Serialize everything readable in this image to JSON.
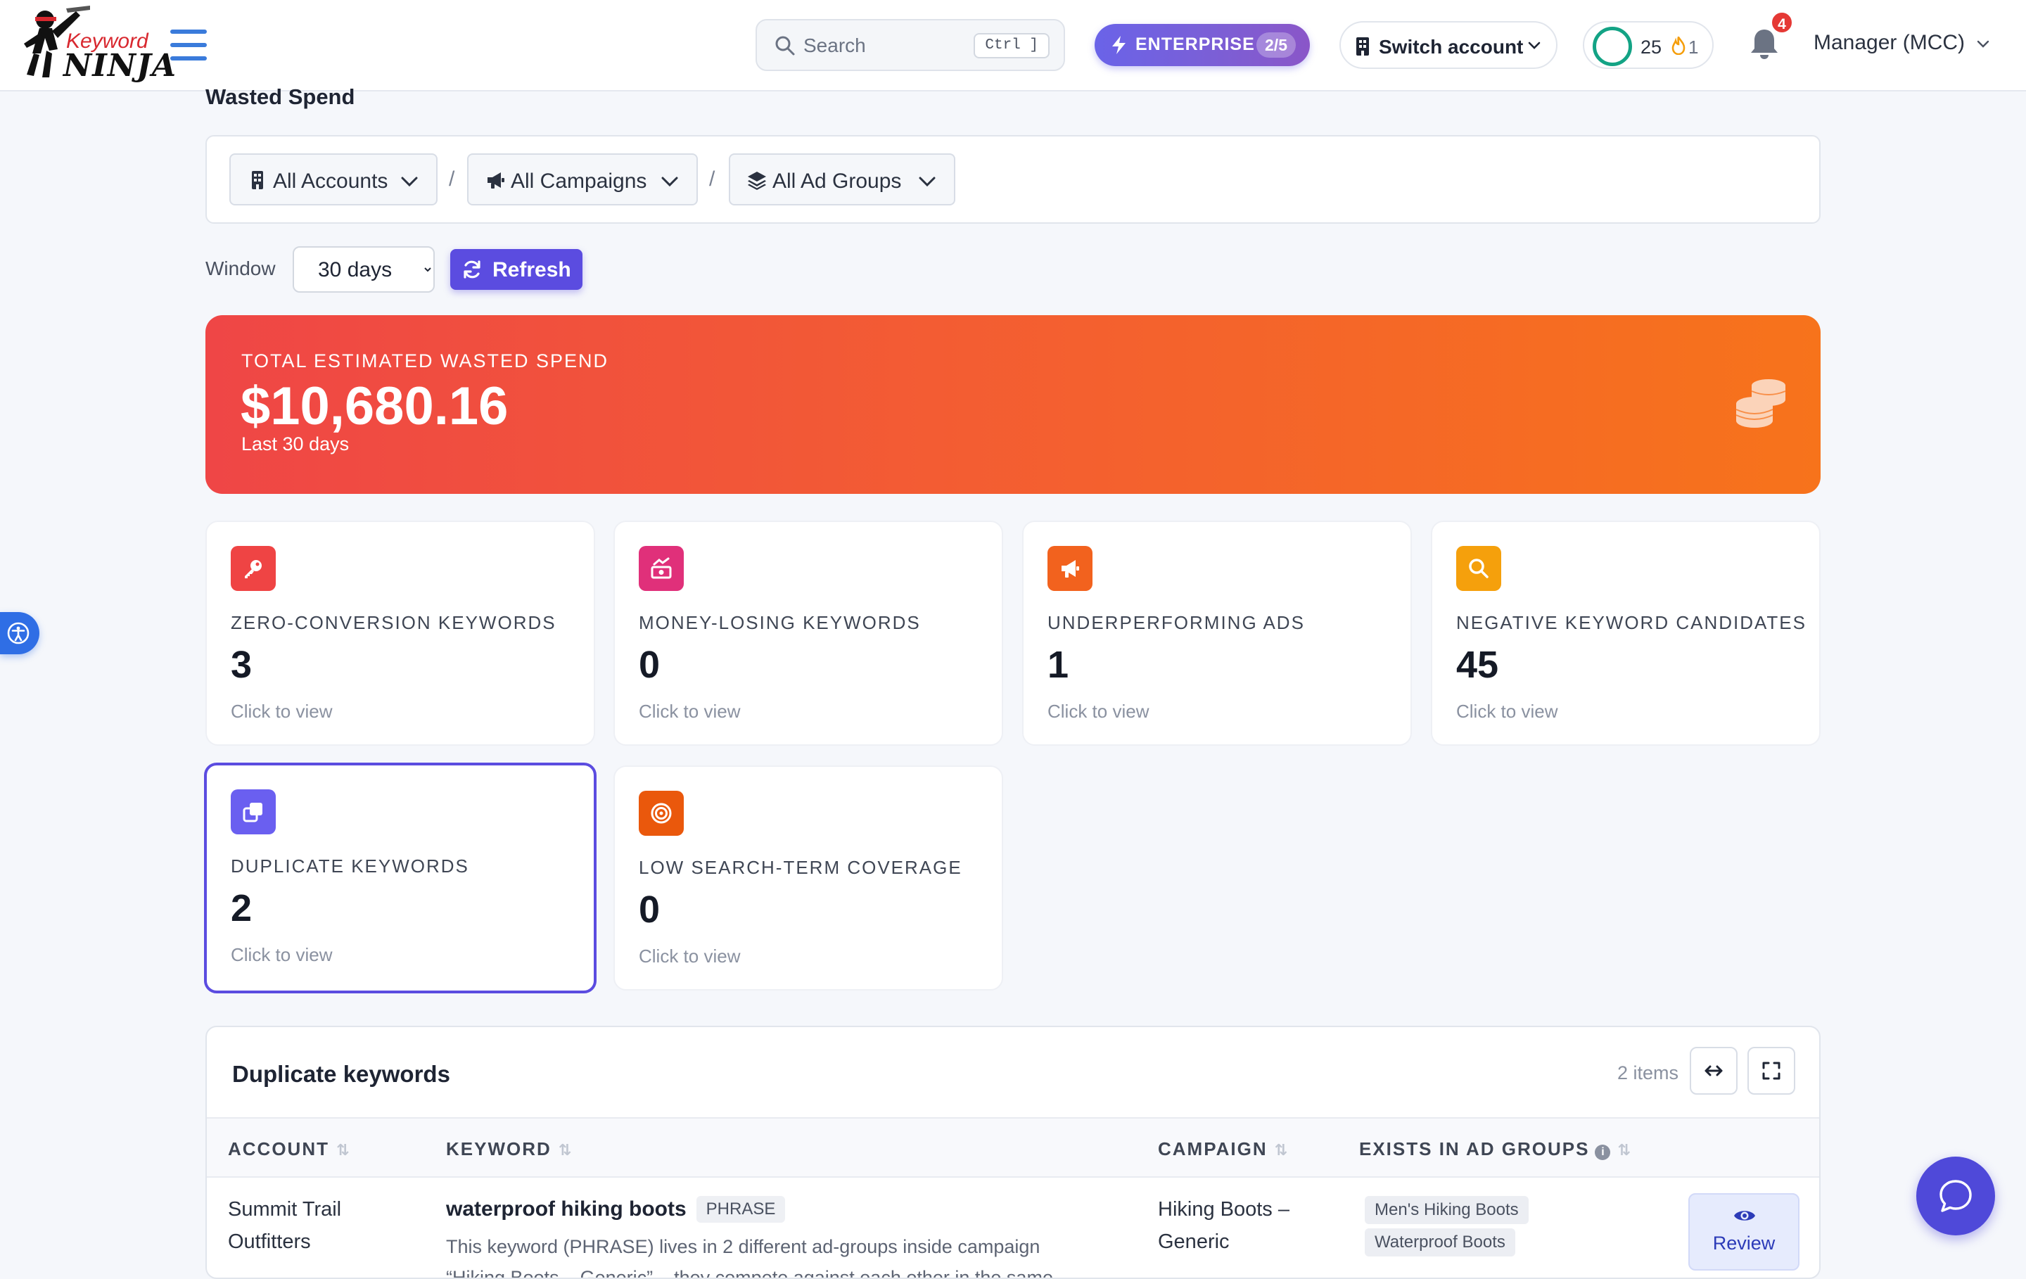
{
  "app": {
    "logo_text_keyword": "Keyword",
    "logo_text_ninja": "NINJA"
  },
  "header": {
    "search_placeholder": "Search",
    "search_shortcut": "Ctrl ]",
    "plan_label": "ENTERPRISE",
    "plan_usage": "2/5",
    "switch_account_label": "Switch account",
    "score_value": "25",
    "streak_value": "1",
    "notification_count": "4",
    "user_label": "Manager (MCC)"
  },
  "page": {
    "title": "Wasted Spend"
  },
  "filters": {
    "accounts": "All Accounts",
    "campaigns": "All Campaigns",
    "ad_groups": "All Ad Groups",
    "separator": "/"
  },
  "window": {
    "label": "Window",
    "selected": "30 days",
    "refresh_label": "Refresh"
  },
  "hero": {
    "label": "TOTAL ESTIMATED WASTED SPEND",
    "value": "$10,680.16",
    "subtitle": "Last 30 days"
  },
  "cards": [
    {
      "title": "ZERO-CONVERSION KEYWORDS",
      "value": "3",
      "hint": "Click to view",
      "icon": "key-icon",
      "color": "#ef4444"
    },
    {
      "title": "MONEY-LOSING KEYWORDS",
      "value": "0",
      "hint": "Click to view",
      "icon": "money-loss-icon",
      "color": "#e0307a"
    },
    {
      "title": "UNDERPERFORMING ADS",
      "value": "1",
      "hint": "Click to view",
      "icon": "megaphone-icon",
      "color": "#f2621e"
    },
    {
      "title": "NEGATIVE KEYWORD CANDIDATES",
      "value": "45",
      "hint": "Click to view",
      "icon": "search-icon",
      "color": "#f5a00c"
    },
    {
      "title": "DUPLICATE KEYWORDS",
      "value": "2",
      "hint": "Click to view",
      "icon": "copy-icon",
      "color": "#6a5ff0"
    },
    {
      "title": "LOW SEARCH-TERM COVERAGE",
      "value": "0",
      "hint": "Click to view",
      "icon": "target-icon",
      "color": "#ea580c"
    }
  ],
  "table": {
    "title": "Duplicate keywords",
    "count_label": "2 items",
    "columns": [
      "ACCOUNT",
      "KEYWORD",
      "CAMPAIGN",
      "EXISTS IN AD GROUPS"
    ],
    "rows": [
      {
        "account_line1": "Summit Trail",
        "account_line2": "Outfitters",
        "keyword": "waterproof hiking boots",
        "match_type": "PHRASE",
        "description_line1": "This keyword (PHRASE) lives in 2 different ad-groups inside campaign",
        "description_line2": "“Hiking Boots – Generic” – they compete against each other in the same",
        "campaign_line1": "Hiking Boots –",
        "campaign_line2": "Generic",
        "ad_groups": [
          "Men's Hiking Boots",
          "Waterproof Boots"
        ],
        "action_label": "Review"
      }
    ]
  },
  "colors": {
    "accent": "#5b4ce0",
    "hero_start": "#ef4646",
    "hero_end": "#f7731b",
    "link_blue": "#3a7bdb"
  }
}
